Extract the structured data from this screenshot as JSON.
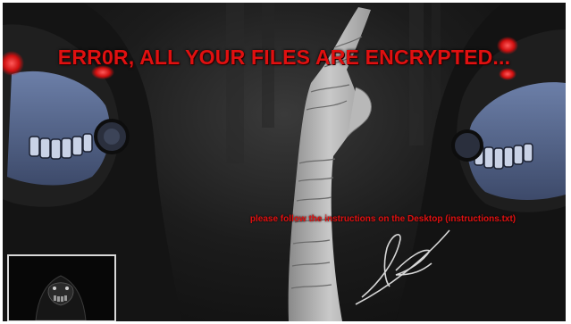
{
  "desktop": {
    "headline": "ERR0R, ALL YOUR FILES ARE ENCRYPTED...",
    "instructions": "please follow the instructions on the Desktop (instructions.txt)"
  },
  "colors": {
    "warning_text": "#e01010",
    "background": "#111111",
    "mask": "#5d6f96",
    "eyes": "#ff2a2a"
  },
  "icons": {
    "left_figure": "hooded-masked-figure",
    "right_figure": "hooded-masked-figure",
    "center_figure": "raised-bandaged-arm",
    "signature": "artist-signature"
  }
}
